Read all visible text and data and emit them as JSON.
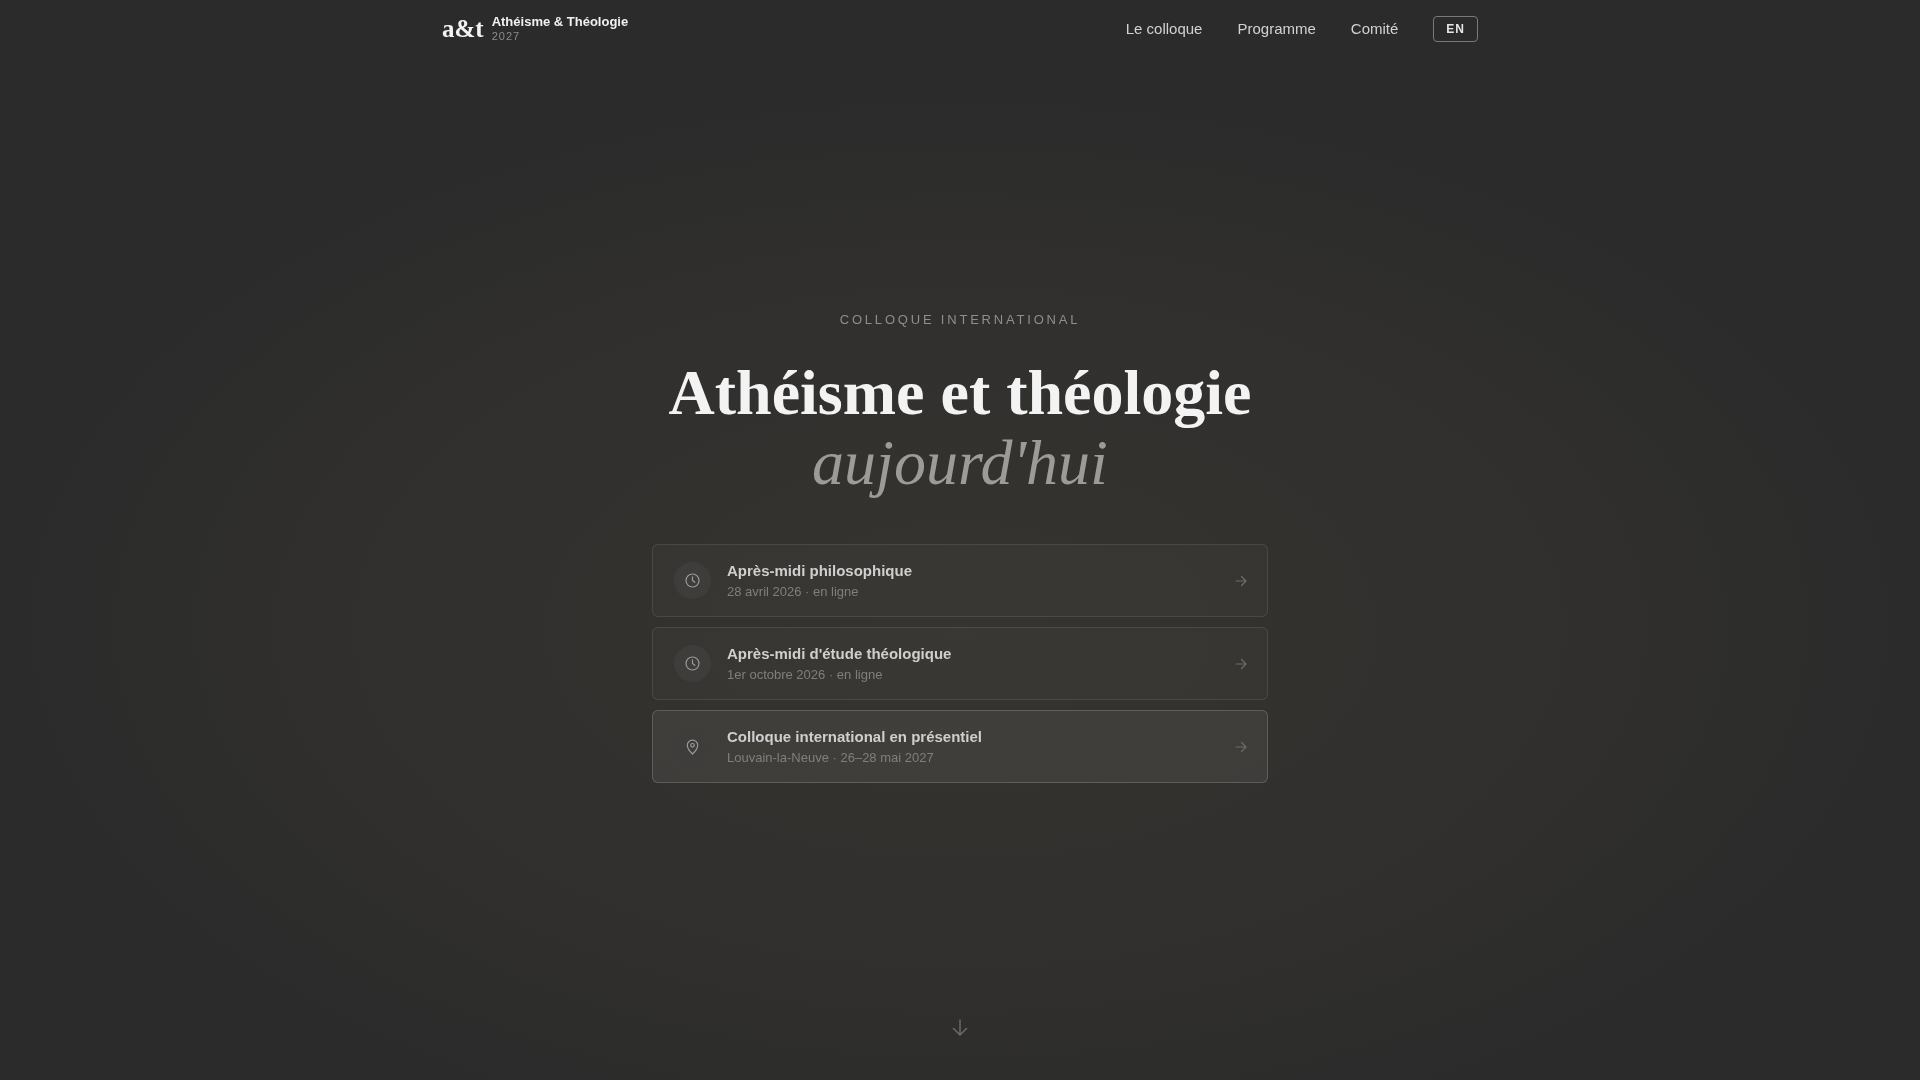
{
  "brand": {
    "logo": "a&t",
    "title": "Athéisme & Théologie",
    "year": "2027"
  },
  "nav": {
    "links": [
      {
        "label": "Le colloque"
      },
      {
        "label": "Programme"
      },
      {
        "label": "Comité"
      }
    ],
    "language_button": "EN"
  },
  "hero": {
    "eyebrow": "COLLOQUE INTERNATIONAL",
    "title": "Athéisme et théologie",
    "subtitle": "aujourd'hui"
  },
  "events": [
    {
      "kind": "clock",
      "title": "Après-midi philosophique",
      "details": "28 avril 2026 · en ligne",
      "highlighted": false
    },
    {
      "kind": "clock",
      "title": "Après-midi d'étude théologique",
      "details": "1er octobre 2026 · en ligne",
      "highlighted": false
    },
    {
      "kind": "pin",
      "title": "Colloque international en présentiel",
      "details": "Louvain-la-Neuve · 26–28 mai 2027",
      "highlighted": true
    }
  ]
}
